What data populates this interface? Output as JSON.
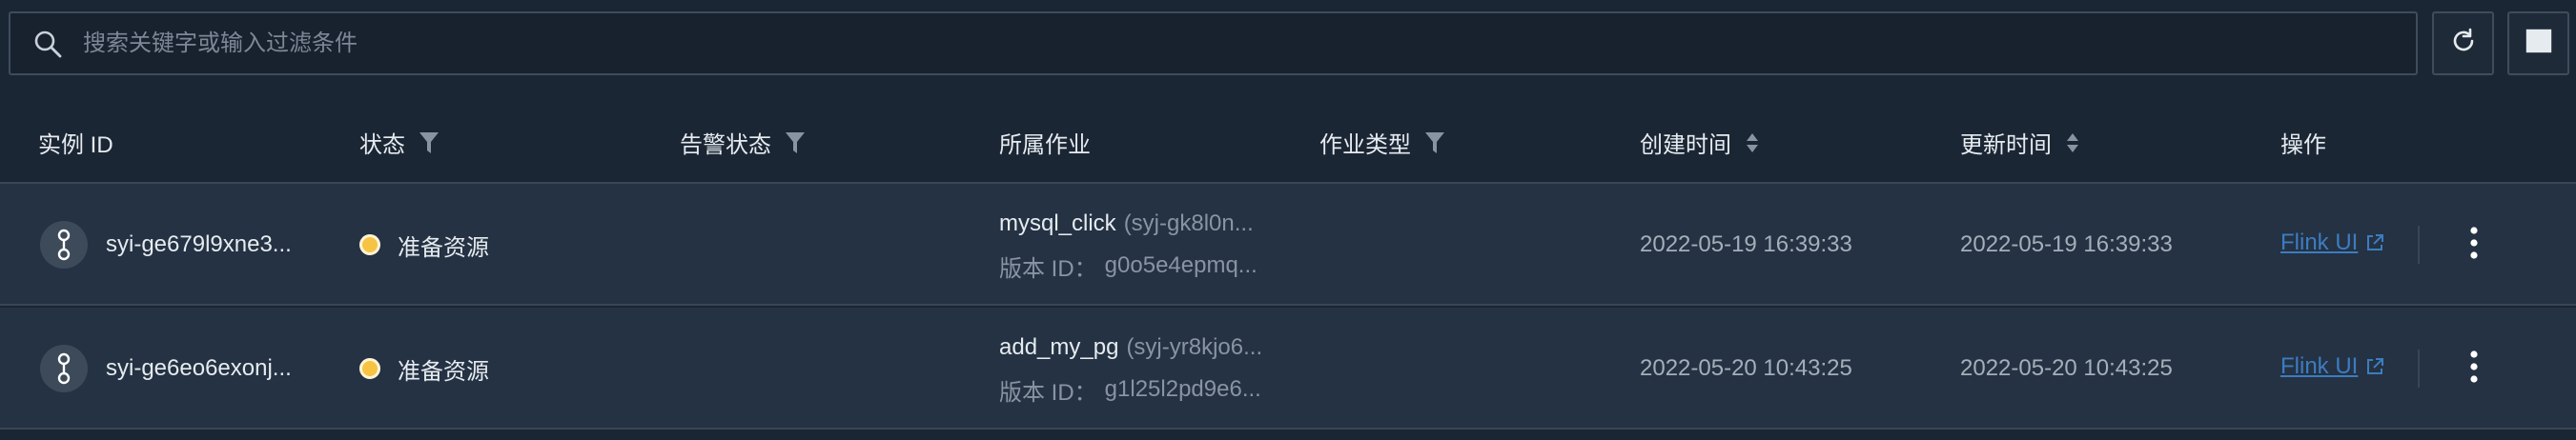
{
  "search": {
    "placeholder": "搜索关键字或输入过滤条件"
  },
  "toolbar": {
    "refresh_icon": "refresh-icon",
    "columns_icon": "columns-icon"
  },
  "columns": {
    "instance_id": "实例 ID",
    "status": "状态",
    "alert_status": "告警状态",
    "job": "所属作业",
    "job_type": "作业类型",
    "created": "创建时间",
    "updated": "更新时间",
    "actions": "操作"
  },
  "rows": [
    {
      "instance_id": "syi-ge679l9xne3...",
      "status": "准备资源",
      "job_name": "mysql_click",
      "job_id": "(syj-gk8l0n...",
      "version_label": "版本 ID：",
      "version_id": "g0o5e4epmq...",
      "created": "2022-05-19 16:39:33",
      "updated": "2022-05-19 16:39:33",
      "action_link": "Flink UI"
    },
    {
      "instance_id": "syi-ge6eo6exonj...",
      "status": "准备资源",
      "job_name": "add_my_pg",
      "job_id": "(syj-yr8kjo6...",
      "version_label": "版本 ID：",
      "version_id": "g1l25l2pd9e6...",
      "created": "2022-05-20 10:43:25",
      "updated": "2022-05-20 10:43:25",
      "action_link": "Flink UI"
    }
  ],
  "colors": {
    "status_preparing": "#f6c343",
    "link": "#3d7cc0",
    "background": "#1b2634"
  }
}
